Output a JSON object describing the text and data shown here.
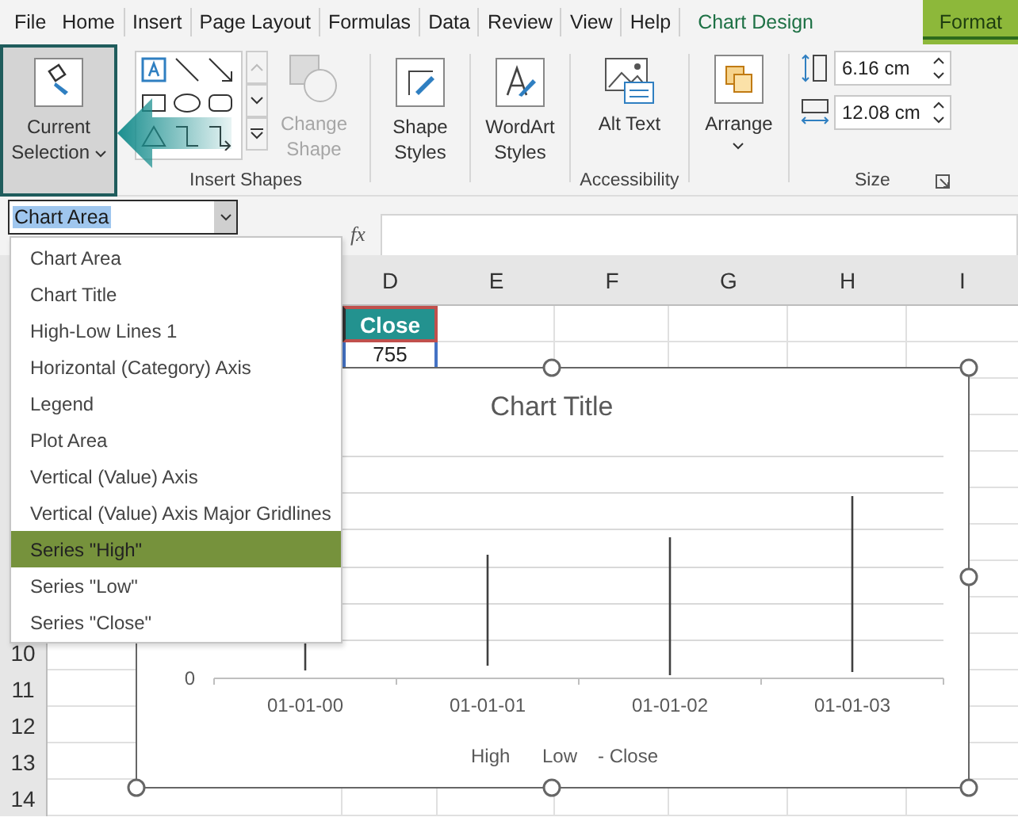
{
  "tabs": [
    {
      "label": "File",
      "kind": "normal",
      "selected": false
    },
    {
      "label": "Home",
      "kind": "normal",
      "selected": false
    },
    {
      "label": "Insert",
      "kind": "normal",
      "selected": false
    },
    {
      "label": "Page Layout",
      "kind": "normal",
      "selected": false
    },
    {
      "label": "Formulas",
      "kind": "normal",
      "selected": false
    },
    {
      "label": "Data",
      "kind": "normal",
      "selected": false
    },
    {
      "label": "Review",
      "kind": "normal",
      "selected": false
    },
    {
      "label": "View",
      "kind": "normal",
      "selected": false
    },
    {
      "label": "Help",
      "kind": "normal",
      "selected": false
    },
    {
      "label": "Chart Design",
      "kind": "contextual",
      "selected": false
    },
    {
      "label": "Format",
      "kind": "contextual",
      "selected": true
    }
  ],
  "ribbon": {
    "current_selection": {
      "label": "Current Selection",
      "selected": true
    },
    "insert_shapes": {
      "change_shape": {
        "label": "Change Shape",
        "disabled": true
      },
      "group_label": "Insert Shapes"
    },
    "shape_styles": {
      "label": "Shape Styles"
    },
    "wordart_styles": {
      "label": "WordArt Styles"
    },
    "accessibility": {
      "alt_text": "Alt Text",
      "group_label": "Accessibility"
    },
    "arrange": {
      "label": "Arrange"
    },
    "size": {
      "height": "6.16 cm",
      "width": "12.08 cm",
      "group_label": "Size"
    }
  },
  "name_box": {
    "value": "Chart Area",
    "expanded": true
  },
  "formula_bar": {
    "fx": "fx"
  },
  "sheet": {
    "columns": [
      "D",
      "E",
      "F",
      "G",
      "H",
      "I"
    ],
    "rows": [
      "10",
      "11",
      "12",
      "13",
      "14"
    ],
    "cells": [
      {
        "text": "Close",
        "kind": "header"
      },
      {
        "text": "755",
        "kind": "value"
      }
    ]
  },
  "dropdown": {
    "items": [
      {
        "label": "Chart Area",
        "selected": false
      },
      {
        "label": "Chart Title",
        "selected": false
      },
      {
        "label": "High-Low Lines 1",
        "selected": false
      },
      {
        "label": "Horizontal (Category) Axis",
        "selected": false
      },
      {
        "label": "Legend",
        "selected": false
      },
      {
        "label": "Plot Area",
        "selected": false
      },
      {
        "label": "Vertical (Value) Axis",
        "selected": false
      },
      {
        "label": "Vertical (Value) Axis Major Gridlines",
        "selected": false
      },
      {
        "label": "Series \"High\"",
        "selected": true
      },
      {
        "label": "Series \"Low\"",
        "selected": false
      },
      {
        "label": "Series \"Close\"",
        "selected": false
      }
    ]
  },
  "chart": {
    "title": "Chart Title",
    "y_ticks": [
      "0"
    ],
    "categories": [
      "01-01-00",
      "01-01-01",
      "01-01-02",
      "01-01-03"
    ],
    "legend": [
      "High",
      "Low",
      "- Close"
    ]
  }
}
